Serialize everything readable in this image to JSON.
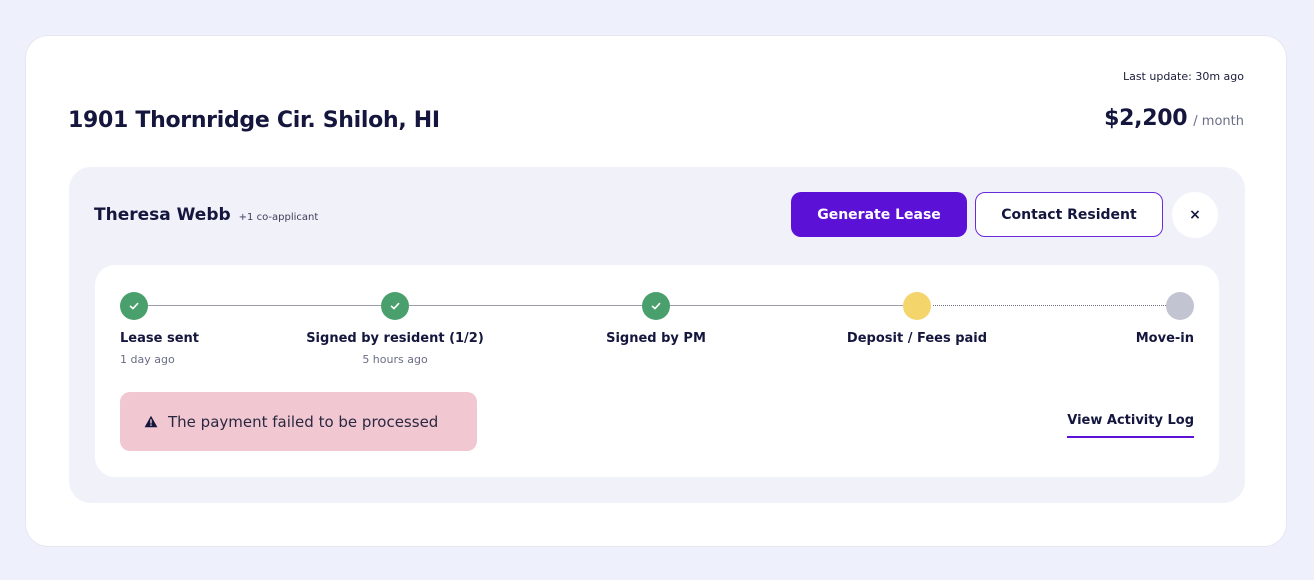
{
  "header": {
    "last_update": "Last update: 30m ago",
    "address": "1901 Thornridge Cir. Shiloh, HI",
    "rent_amount": "$2,200",
    "rent_unit": "/ month"
  },
  "applicant": {
    "name": "Theresa Webb",
    "co_applicant": "+1 co-applicant"
  },
  "actions": {
    "generate_lease": "Generate Lease",
    "contact_resident": "Contact Resident",
    "close": "×"
  },
  "steps": [
    {
      "label": "Lease sent",
      "sub": "1 day ago",
      "status": "done"
    },
    {
      "label": "Signed by resident (1/2)",
      "sub": "5 hours ago",
      "status": "done"
    },
    {
      "label": "Signed by PM",
      "sub": "",
      "status": "done"
    },
    {
      "label": "Deposit / Fees paid",
      "sub": "",
      "status": "current"
    },
    {
      "label": "Move-in",
      "sub": "",
      "status": "pending"
    }
  ],
  "alert": {
    "icon": "warning-icon",
    "message": "The payment failed to be processed"
  },
  "activity_log": {
    "label": "View Activity Log"
  },
  "colors": {
    "accent": "#5b12d6",
    "done": "#4aa06d",
    "current": "#f4d56c",
    "pending": "#c3c4d1",
    "alert_bg": "#f1c8d1"
  }
}
